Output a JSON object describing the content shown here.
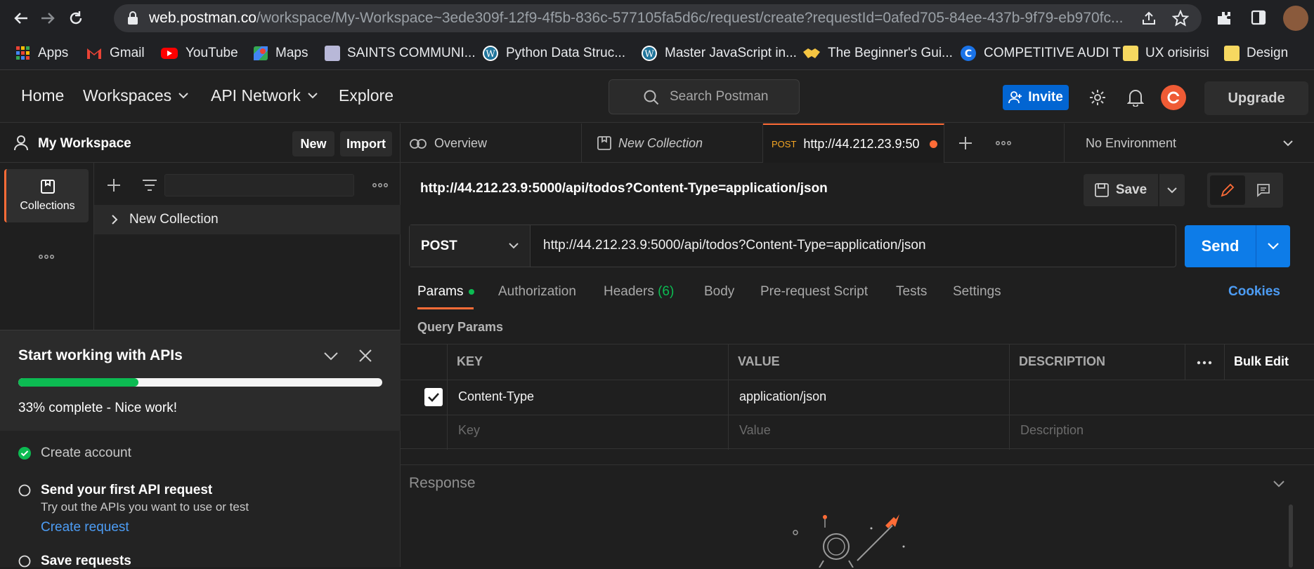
{
  "browser": {
    "url_host": "web.postman.co",
    "url_path": "/workspace/My-Workspace~3ede309f-12f9-4f5b-836c-577105fa5d6c/request/create?requestId=0afed705-84ee-437b-9f79-eb970fc...",
    "bookmarks": [
      {
        "label": "Apps",
        "icon": "apps-grid-icon",
        "color": "#ea4335"
      },
      {
        "label": "Gmail",
        "icon": "gmail-icon",
        "color": "#ea4335"
      },
      {
        "label": "YouTube",
        "icon": "youtube-icon",
        "color": "#ff0000"
      },
      {
        "label": "Maps",
        "icon": "maps-icon",
        "color": "#34a853"
      },
      {
        "label": "SAINTS COMMUNI...",
        "icon": "saints-icon",
        "color": "#c0c0e0"
      },
      {
        "label": "Python  Data Struc...",
        "icon": "wordpress-icon",
        "color": "#ffffff"
      },
      {
        "label": "Master JavaScript in...",
        "icon": "wordpress-icon",
        "color": "#ffffff"
      },
      {
        "label": "The Beginner's Gui...",
        "icon": "handshake-icon",
        "color": "#f5c542"
      },
      {
        "label": "COMPETITIVE AUDI T",
        "icon": "c-logo-icon",
        "color": "#1a73e8"
      },
      {
        "label": "UX orisirisi",
        "icon": "note-icon",
        "color": "#f6d860"
      },
      {
        "label": "Design",
        "icon": "note-icon",
        "color": "#f6d860"
      }
    ]
  },
  "header": {
    "nav": [
      "Home",
      "Workspaces",
      "API Network",
      "Explore"
    ],
    "search_placeholder": "Search Postman",
    "invite": "Invite",
    "upgrade": "Upgrade"
  },
  "sidebar": {
    "workspace": "My Workspace",
    "new": "New",
    "import": "Import",
    "rail_collections": "Collections",
    "collection_item": "New Collection"
  },
  "onboarding": {
    "title": "Start working with APIs",
    "progress": 0.33,
    "progress_text": "33% complete - Nice work!",
    "steps": [
      {
        "label": "Create account",
        "done": true
      },
      {
        "label": "Send your first API request",
        "done": false,
        "desc": "Try out the APIs you want to use or test",
        "link": "Create request"
      },
      {
        "label": "Save requests",
        "done": false
      }
    ]
  },
  "tabs": {
    "overview": "Overview",
    "collection": "New Collection",
    "active_method": "POST",
    "active_url": "http://44.212.23.9:50",
    "environment": "No Environment"
  },
  "request": {
    "title": "http://44.212.23.9:5000/api/todos?Content-Type=application/json",
    "save": "Save",
    "method": "POST",
    "url": "http://44.212.23.9:5000/api/todos?Content-Type=application/json",
    "send": "Send",
    "subtabs": {
      "params": "Params",
      "authorization": "Authorization",
      "headers": "Headers",
      "headers_count": "(6)",
      "body": "Body",
      "prerequest": "Pre-request Script",
      "tests": "Tests",
      "settings": "Settings",
      "cookies": "Cookies"
    },
    "query_params_title": "Query Params",
    "columns": {
      "key": "KEY",
      "value": "VALUE",
      "description": "DESCRIPTION",
      "bulk_edit": "Bulk Edit"
    },
    "rows": [
      {
        "key": "Content-Type",
        "value": "application/json",
        "description": "",
        "checked": true
      }
    ],
    "placeholders": {
      "key": "Key",
      "value": "Value",
      "description": "Description"
    }
  },
  "response": {
    "label": "Response"
  },
  "colors": {
    "accent": "#ff6c37",
    "blue": "#0d7ce8",
    "green": "#0cbb52"
  }
}
